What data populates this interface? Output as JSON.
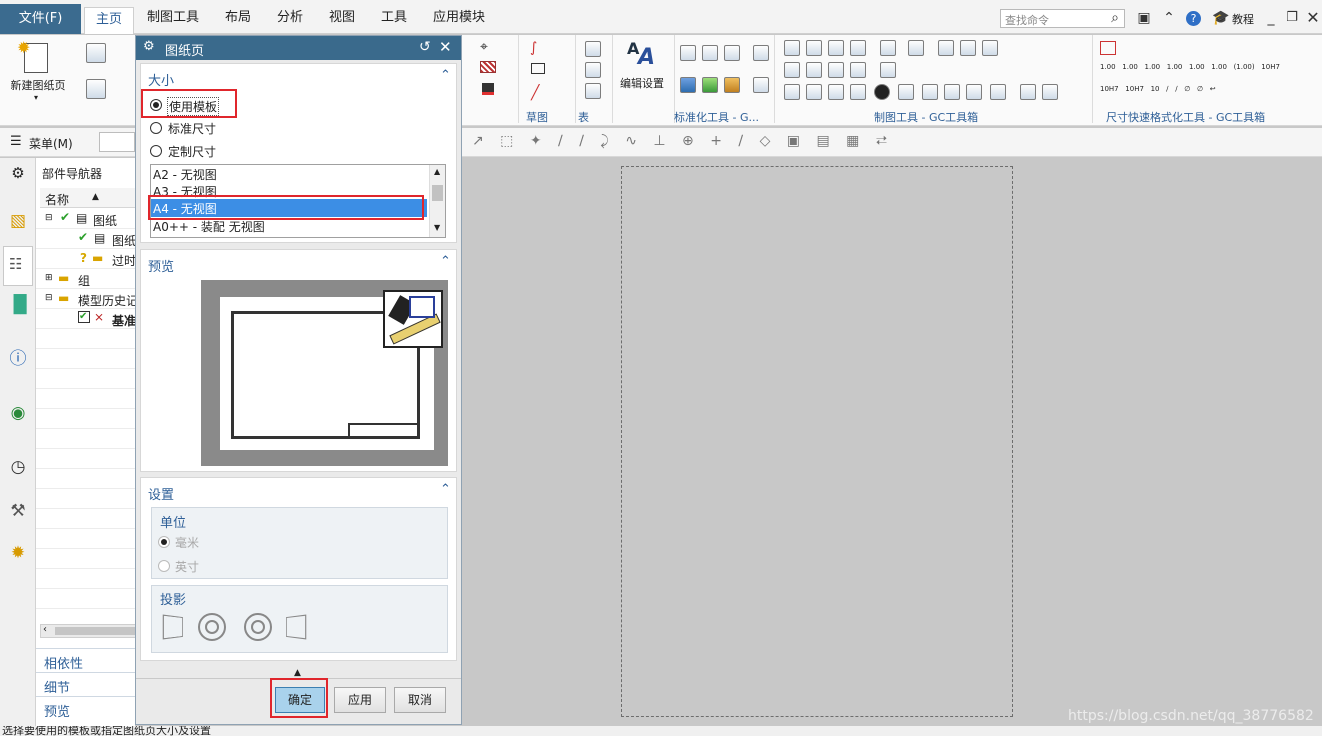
{
  "menubar": {
    "tabs": [
      "文件(F)",
      "主页",
      "制图工具",
      "布局",
      "分析",
      "视图",
      "工具",
      "应用模块"
    ],
    "search_placeholder": "查找命令",
    "tutorial": "教程"
  },
  "ribbon": {
    "new_sheet_label": "新建图纸页",
    "edit_settings_label": "编辑设置",
    "group_labels": {
      "sketch": "草图",
      "table": "表",
      "standard_tools": "标准化工具 - G...",
      "drafting_tools": "制图工具 - GC工具箱",
      "dimension_tools": "尺寸快速格式化工具 - GC工具箱"
    }
  },
  "toolbar2": {
    "menu_label": "菜单(M)"
  },
  "navigator": {
    "title": "部件导航器",
    "column_name": "名称",
    "items": [
      "图纸",
      "图纸",
      "过时",
      "组",
      "模型历史记",
      "基准"
    ],
    "bottom_sections": [
      "相依性",
      "细节",
      "预览"
    ]
  },
  "dialog": {
    "title": "图纸页",
    "size_section": "大小",
    "radio_options": [
      "使用模板",
      "标准尺寸",
      "定制尺寸"
    ],
    "selected_option": "使用模板",
    "template_list": [
      "A2 - 无视图",
      "A3 - 无视图",
      "A4 - 无视图",
      "A0++ - 装配 无视图"
    ],
    "selected_template": "A4 - 无视图",
    "preview_section": "预览",
    "settings_section": "设置",
    "units_label": "单位",
    "unit_options": [
      "毫米",
      "英寸"
    ],
    "projection_label": "投影",
    "buttons": {
      "ok": "确定",
      "apply": "应用",
      "cancel": "取消"
    }
  },
  "status_bar": {
    "text": "选择要使用的模板或指定图纸页大小及设置"
  },
  "watermark": "https://blog.csdn.net/qq_38776582",
  "colors": {
    "title_bar": "#3a6a8c",
    "accent_text": "#2e5f97",
    "highlight": "#3c8ee5",
    "annotation_red": "#e0262c"
  }
}
